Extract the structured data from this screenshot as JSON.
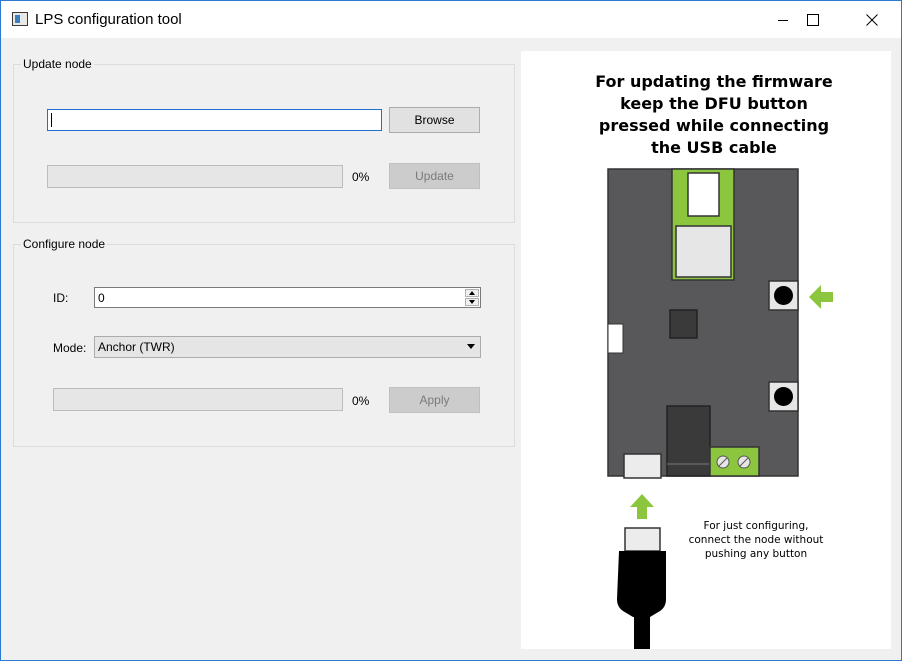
{
  "window": {
    "title": "LPS configuration tool",
    "controls": [
      "minimize",
      "maximize",
      "close"
    ]
  },
  "update_node": {
    "group_title": "Update node",
    "file_path": "",
    "browse_label": "Browse",
    "progress_value": 0,
    "progress_text": "0%",
    "update_label": "Update",
    "update_enabled": false
  },
  "configure_node": {
    "group_title": "Configure node",
    "id_label": "ID:",
    "id_value": "0",
    "mode_label": "Mode:",
    "mode_value": "Anchor (TWR)",
    "progress_value": 0,
    "progress_text": "0%",
    "apply_label": "Apply",
    "apply_enabled": false
  },
  "instructions": {
    "heading_lines": [
      "For updating the firmware",
      "keep the DFU button",
      "pressed while connecting",
      "the USB cable"
    ],
    "note_lines": [
      "For just configuring,",
      "connect the node without",
      "pushing any button"
    ]
  },
  "colors": {
    "accent_green": "#8cc63f",
    "board": "#58585a",
    "focus_blue": "#1e6fcf",
    "title_border": "#2b79d0"
  }
}
